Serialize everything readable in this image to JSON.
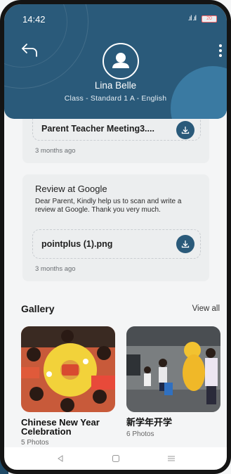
{
  "status_bar": {
    "time": "14:42",
    "signal": ".ıl .ıl",
    "battery": "20"
  },
  "header": {
    "user_name": "Lina Belle",
    "class_info": "Class - Standard 1 A - English"
  },
  "posts": [
    {
      "attachment": "Parent Teacher Meeting3....",
      "time": "3 months ago"
    },
    {
      "title": "Review at Google",
      "body": "Dear Parent,  Kindly help us to scan and write a review at Google. Thank you very much.",
      "attachment": "pointplus (1).png",
      "time": "3 months ago"
    }
  ],
  "gallery": {
    "title": "Gallery",
    "view_all": "View all",
    "albums": [
      {
        "title": "Chinese New Year Celebration",
        "count": "5 Photos"
      },
      {
        "title": "新学年开学",
        "count": "6 Photos"
      }
    ]
  },
  "colors": {
    "primary": "#2a5a7a",
    "card_bg": "#eceeef",
    "background": "#f4f5f6"
  },
  "icons": {
    "back": "back-arrow-icon",
    "more": "more-vertical-icon",
    "avatar": "user-avatar-icon",
    "download": "download-icon",
    "nav_back": "nav-back-icon",
    "nav_home": "nav-home-icon",
    "nav_recent": "nav-recent-icon"
  }
}
